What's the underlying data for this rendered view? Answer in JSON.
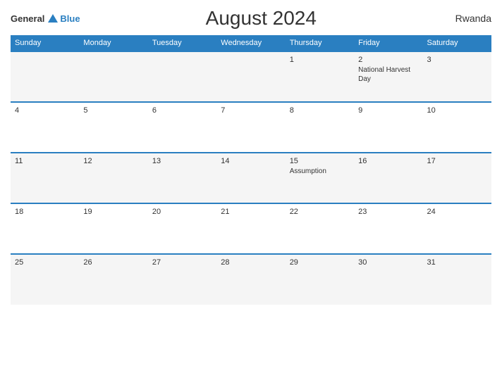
{
  "header": {
    "logo_general": "General",
    "logo_blue": "Blue",
    "title": "August 2024",
    "country": "Rwanda"
  },
  "days_of_week": [
    "Sunday",
    "Monday",
    "Tuesday",
    "Wednesday",
    "Thursday",
    "Friday",
    "Saturday"
  ],
  "weeks": [
    [
      {
        "date": "",
        "event": ""
      },
      {
        "date": "",
        "event": ""
      },
      {
        "date": "",
        "event": ""
      },
      {
        "date": "",
        "event": ""
      },
      {
        "date": "1",
        "event": ""
      },
      {
        "date": "2",
        "event": "National Harvest Day"
      },
      {
        "date": "3",
        "event": ""
      }
    ],
    [
      {
        "date": "4",
        "event": ""
      },
      {
        "date": "5",
        "event": ""
      },
      {
        "date": "6",
        "event": ""
      },
      {
        "date": "7",
        "event": ""
      },
      {
        "date": "8",
        "event": ""
      },
      {
        "date": "9",
        "event": ""
      },
      {
        "date": "10",
        "event": ""
      }
    ],
    [
      {
        "date": "11",
        "event": ""
      },
      {
        "date": "12",
        "event": ""
      },
      {
        "date": "13",
        "event": ""
      },
      {
        "date": "14",
        "event": ""
      },
      {
        "date": "15",
        "event": "Assumption"
      },
      {
        "date": "16",
        "event": ""
      },
      {
        "date": "17",
        "event": ""
      }
    ],
    [
      {
        "date": "18",
        "event": ""
      },
      {
        "date": "19",
        "event": ""
      },
      {
        "date": "20",
        "event": ""
      },
      {
        "date": "21",
        "event": ""
      },
      {
        "date": "22",
        "event": ""
      },
      {
        "date": "23",
        "event": ""
      },
      {
        "date": "24",
        "event": ""
      }
    ],
    [
      {
        "date": "25",
        "event": ""
      },
      {
        "date": "26",
        "event": ""
      },
      {
        "date": "27",
        "event": ""
      },
      {
        "date": "28",
        "event": ""
      },
      {
        "date": "29",
        "event": ""
      },
      {
        "date": "30",
        "event": ""
      },
      {
        "date": "31",
        "event": ""
      }
    ]
  ],
  "colors": {
    "header_bg": "#2a7fc1",
    "header_text": "#ffffff",
    "border": "#2a7fc1",
    "row_odd": "#f0f0f0",
    "row_even": "#ffffff"
  }
}
